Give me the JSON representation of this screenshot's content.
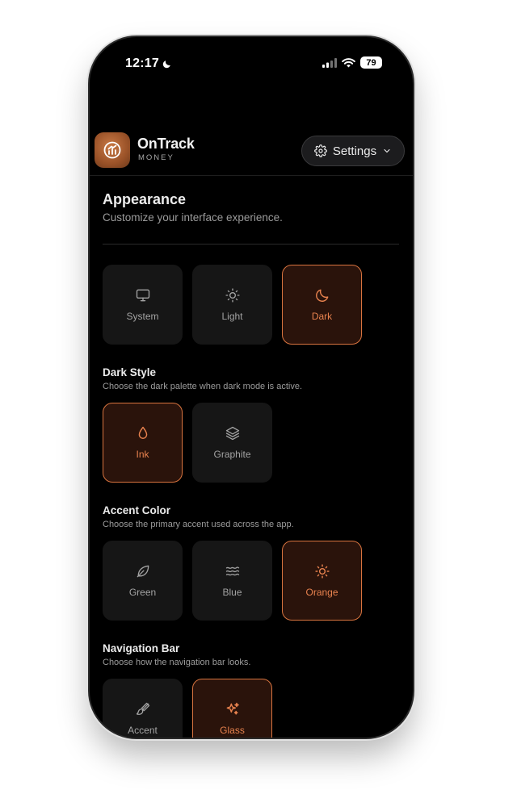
{
  "status_bar": {
    "time": "12:17",
    "battery": "79"
  },
  "header": {
    "brand_name": "OnTrack",
    "brand_sub": "MONEY",
    "settings_label": "Settings"
  },
  "appearance": {
    "title": "Appearance",
    "subtitle": "Customize your interface experience.",
    "options": [
      {
        "label": "System",
        "icon": "monitor-icon",
        "selected": false
      },
      {
        "label": "Light",
        "icon": "sun-icon",
        "selected": false
      },
      {
        "label": "Dark",
        "icon": "moon-icon",
        "selected": true
      }
    ]
  },
  "dark_style": {
    "title": "Dark Style",
    "description": "Choose the dark palette when dark mode is active.",
    "options": [
      {
        "label": "Ink",
        "icon": "droplet-icon",
        "selected": true
      },
      {
        "label": "Graphite",
        "icon": "layers-icon",
        "selected": false
      }
    ]
  },
  "accent_color": {
    "title": "Accent Color",
    "description": "Choose the primary accent used across the app.",
    "options": [
      {
        "label": "Green",
        "icon": "leaf-icon",
        "selected": false
      },
      {
        "label": "Blue",
        "icon": "waves-icon",
        "selected": false
      },
      {
        "label": "Orange",
        "icon": "sun-icon",
        "selected": true
      }
    ]
  },
  "navigation_bar": {
    "title": "Navigation Bar",
    "description": "Choose how the navigation bar looks.",
    "options": [
      {
        "label": "Accent",
        "icon": "paintbrush-icon",
        "selected": false
      },
      {
        "label": "Glass",
        "icon": "sparkles-icon",
        "selected": true
      }
    ]
  },
  "colors": {
    "accent": "#d9743f",
    "accent_text": "#e8824e",
    "background": "#000000",
    "tile": "#161616"
  }
}
